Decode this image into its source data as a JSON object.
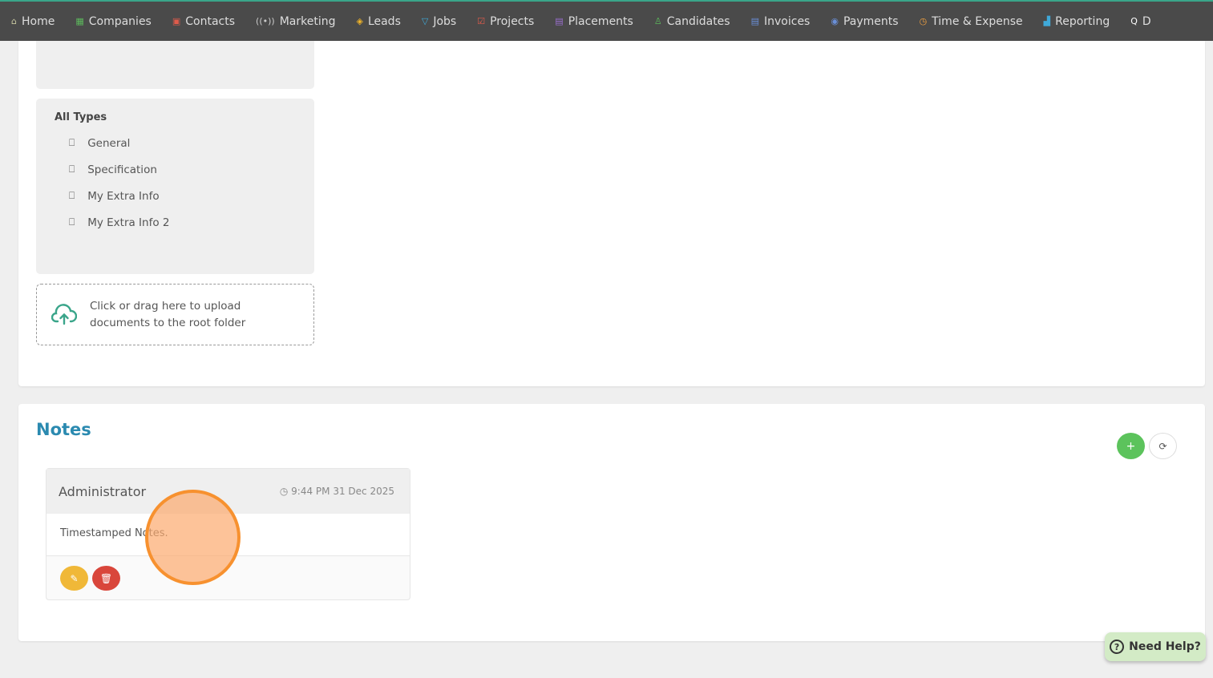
{
  "nav": {
    "items": [
      {
        "label": "Home",
        "icon": "home-icon",
        "glyph": "⌂",
        "color": "#c8c8a0"
      },
      {
        "label": "Companies",
        "icon": "building-icon",
        "glyph": "▦",
        "color": "#5cb85c"
      },
      {
        "label": "Contacts",
        "icon": "contact-card-icon",
        "glyph": "▣",
        "color": "#e05b4b"
      },
      {
        "label": "Marketing",
        "icon": "broadcast-icon",
        "glyph": "((•))",
        "color": "#ccc"
      },
      {
        "label": "Leads",
        "icon": "target-icon",
        "glyph": "◈",
        "color": "#f0b429"
      },
      {
        "label": "Jobs",
        "icon": "trophy-icon",
        "glyph": "▽",
        "color": "#3fa9d9"
      },
      {
        "label": "Projects",
        "icon": "checkbox-icon",
        "glyph": "☑",
        "color": "#e05b4b"
      },
      {
        "label": "Placements",
        "icon": "briefcase-icon",
        "glyph": "▤",
        "color": "#9b6fd0"
      },
      {
        "label": "Candidates",
        "icon": "users-icon",
        "glyph": "♙",
        "color": "#5cb85c"
      },
      {
        "label": "Invoices",
        "icon": "document-icon",
        "glyph": "▤",
        "color": "#6a8fd8"
      },
      {
        "label": "Payments",
        "icon": "coins-icon",
        "glyph": "◉",
        "color": "#6a8fd8"
      },
      {
        "label": "Time & Expense",
        "icon": "clock-icon",
        "glyph": "◷",
        "color": "#f0a040"
      },
      {
        "label": "Reporting",
        "icon": "bar-chart-icon",
        "glyph": "▟",
        "color": "#3fa9d9"
      },
      {
        "label": "D",
        "icon": "search-icon",
        "glyph": "Q",
        "color": "#fff"
      }
    ]
  },
  "documents": {
    "types_heading": "All Types",
    "types": [
      "General",
      "Specification",
      "My Extra Info",
      "My Extra Info 2"
    ],
    "upload_text": "Click or drag here to upload documents to the root folder"
  },
  "notes": {
    "title": "Notes",
    "add_label": "+",
    "refresh_label": "⟳",
    "items": [
      {
        "author": "Administrator",
        "time": "9:44 PM 31 Dec 2025",
        "text": "Timestamped Notes."
      }
    ]
  },
  "help": {
    "label": "Need Help?"
  },
  "colors": {
    "accent": "#2b8ab0",
    "add": "#5cb85c",
    "edit": "#f0b838",
    "delete": "#d9463b"
  }
}
